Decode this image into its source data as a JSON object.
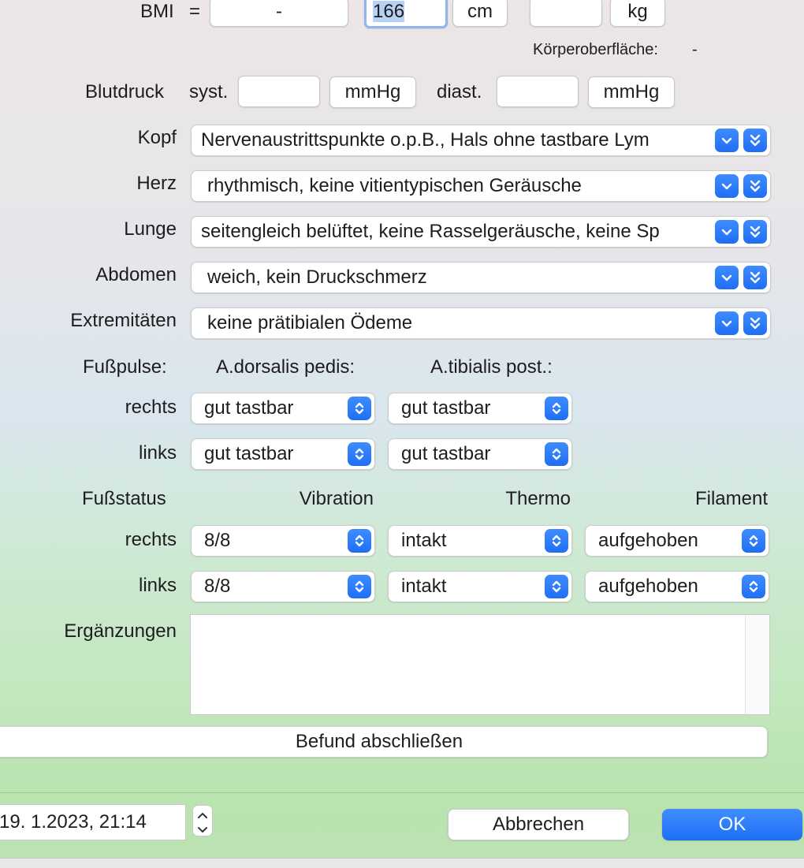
{
  "bmi": {
    "label": "BMI",
    "equals": "=",
    "value": "-",
    "height_value": "166",
    "height_unit": "cm",
    "weight_value": "",
    "weight_unit": "kg",
    "body_surface_label": "Körperoberfläche:",
    "body_surface_value": "-"
  },
  "blood_pressure": {
    "label": "Blutdruck",
    "syst_label": "syst.",
    "syst_value": "",
    "syst_unit": "mmHg",
    "diast_label": "diast.",
    "diast_value": "",
    "diast_unit": "mmHg"
  },
  "findings": [
    {
      "label": "Kopf",
      "value": "Nervenaustrittspunkte o.p.B., Hals ohne tastbare Lym"
    },
    {
      "label": "Herz",
      "value": "rhythmisch, keine vitientypischen Geräusche"
    },
    {
      "label": "Lunge",
      "value": "seitengleich belüftet, keine Rasselgeräusche, keine Sp"
    },
    {
      "label": "Abdomen",
      "value": "weich, kein Druckschmerz"
    },
    {
      "label": "Extremitäten",
      "value": "keine prätibialen Ödeme"
    }
  ],
  "foot_pulses": {
    "label": "Fußpulse:",
    "col1": "A.dorsalis pedis:",
    "col2": "A.tibialis post.:",
    "rows": [
      {
        "label": "rechts",
        "dorsalis": "gut tastbar",
        "tibialis": "gut tastbar"
      },
      {
        "label": "links",
        "dorsalis": "gut tastbar",
        "tibialis": "gut tastbar"
      }
    ]
  },
  "foot_status": {
    "label": "Fußstatus",
    "col1": "Vibration",
    "col2": "Thermo",
    "col3": "Filament",
    "rows": [
      {
        "label": "rechts",
        "vibration": "8/8",
        "thermo": "intakt",
        "filament": "aufgehoben"
      },
      {
        "label": "links",
        "vibration": "8/8",
        "thermo": "intakt",
        "filament": "aufgehoben"
      }
    ]
  },
  "supplements": {
    "label": "Ergänzungen",
    "value": ""
  },
  "finish_button": "Befund abschließen",
  "footer": {
    "datetime": "19.  1.2023, 21:14",
    "cancel": "Abbrechen",
    "ok": "OK"
  },
  "colors": {
    "accent": "#2a77f6"
  }
}
